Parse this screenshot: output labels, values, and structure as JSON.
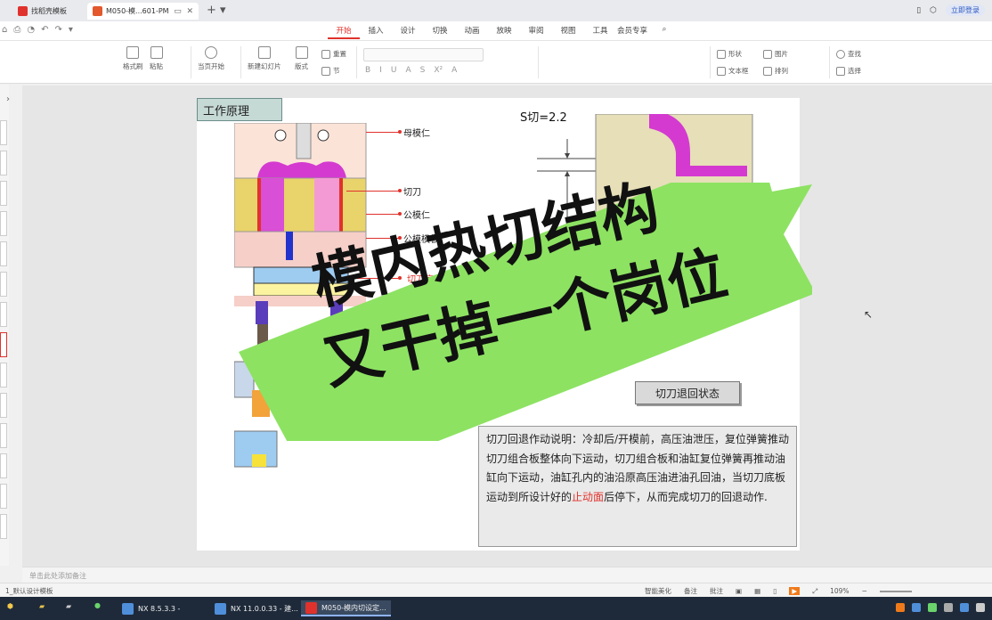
{
  "tabs": [
    {
      "label": "找稻壳模板",
      "active": false
    },
    {
      "label": "M050-模...601-PM",
      "active": true
    }
  ],
  "account": {
    "login_label": "立即登录"
  },
  "menu": [
    "开始",
    "插入",
    "设计",
    "切换",
    "动画",
    "放映",
    "审阅",
    "视图",
    "工具",
    "会员专享"
  ],
  "menu_active": "开始",
  "ribbon": {
    "format_painter": "格式刷",
    "paste": "粘贴",
    "play_from_current": "当页开始",
    "new_slide": "新建幻灯片",
    "layout": "版式",
    "reset": "重置",
    "section": "节",
    "shape": "形状",
    "picture": "图片",
    "textbox": "文本框",
    "arrange": "排列",
    "find": "查找",
    "select": "选择"
  },
  "slide": {
    "title": "工作原理",
    "labels": {
      "female_insert": "母模仁",
      "cutter": "切刀",
      "male_insert": "公模仁",
      "male_plate": "公模模板",
      "cutter_bottom_plate": "切刀底"
    },
    "s_cut": "S切=2.2",
    "state": "切刀退回状态",
    "description": {
      "pre": "切刀回退作动说明：冷却后/开模前，高压油泄压，复位弹簧推动切刀组合板整体向下运动，切刀组合板和油缸复位弹簧再推动油缸向下运动，油缸孔内的油沿原高压油进油孔回油，当切刀底板运动到所设计好的",
      "highlight": "止动面",
      "post": "后停下，从而完成切刀的回退动作."
    }
  },
  "overlay": {
    "line1": "模内热切结构",
    "line2": "又干掉一个岗位",
    "color": "#8de262"
  },
  "notes_placeholder": "单击此处添加备注",
  "status": {
    "slide_info": "1_默认设计模板",
    "smart_beautify": "智能美化",
    "notes": "备注",
    "comment": "批注",
    "zoom": "109%"
  },
  "taskbar": [
    {
      "label": "NX 8.5.3.3 -"
    },
    {
      "label": "NX 11.0.0.33 - 建..."
    },
    {
      "label": "M050-模内切设定..."
    }
  ],
  "colors": {
    "accent": "#e0322c",
    "taskbar": "#1e2a3a"
  }
}
